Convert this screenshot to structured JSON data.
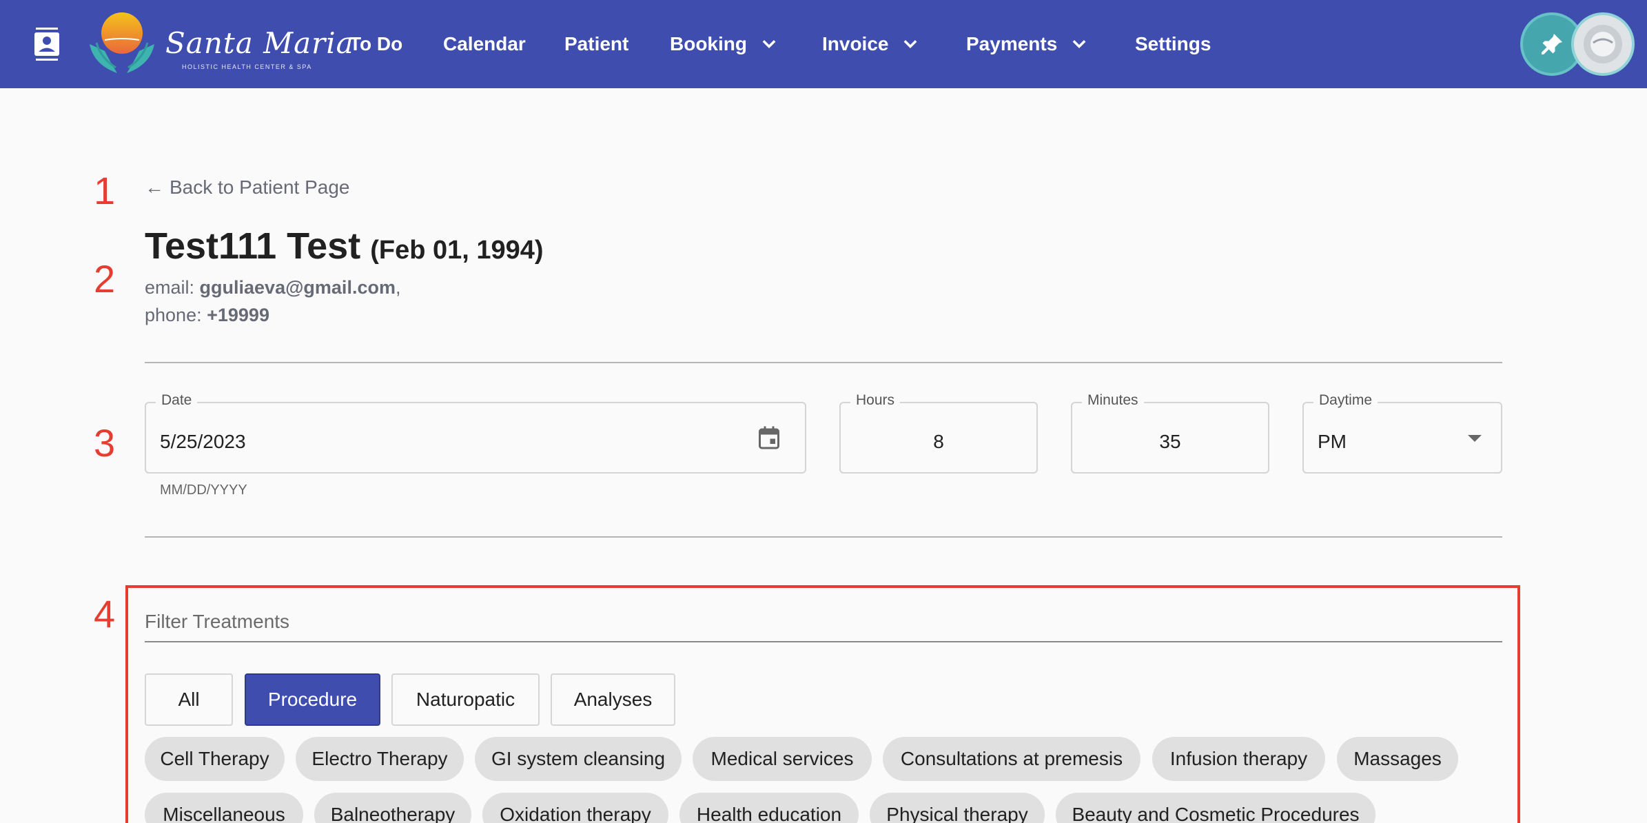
{
  "header": {
    "brand_name": "Santa Maria",
    "brand_tagline": "HOLISTIC HEALTH CENTER & SPA",
    "nav": [
      {
        "label": "To Do"
      },
      {
        "label": "Calendar"
      },
      {
        "label": "Patient"
      },
      {
        "label": "Booking"
      },
      {
        "label": "Invoice"
      },
      {
        "label": "Payments"
      },
      {
        "label": "Settings"
      }
    ],
    "accent_color": "#3f4eae"
  },
  "annotations": [
    "1",
    "2",
    "3",
    "4"
  ],
  "back_link": {
    "arrow": "←",
    "label": "Back to Patient Page"
  },
  "patient": {
    "name": "Test111 Test",
    "dob": "(Feb 01, 1994)",
    "email_label": "email:",
    "email": "gguliaeva@gmail.com",
    "email_suffix": ",",
    "phone_label": "phone:",
    "phone": "+19999"
  },
  "appointment": {
    "date_label": "Date",
    "date_value": "5/25/2023",
    "date_helper": "MM/DD/YYYY",
    "hours_label": "Hours",
    "hours_value": "8",
    "minutes_label": "Minutes",
    "minutes_value": "35",
    "daytime_label": "Daytime",
    "daytime_value": "PM"
  },
  "filter": {
    "placeholder": "Filter Treatments",
    "segments": [
      {
        "label": "All",
        "active": false
      },
      {
        "label": "Procedure",
        "active": true
      },
      {
        "label": "Naturopatic",
        "active": false
      },
      {
        "label": "Analyses",
        "active": false
      }
    ],
    "chips": [
      {
        "label": "Cell Therapy"
      },
      {
        "label": "Electro Therapy"
      },
      {
        "label": "GI system cleansing"
      },
      {
        "label": "Medical services"
      },
      {
        "label": "Consultations at premesis"
      },
      {
        "label": "Infusion therapy"
      },
      {
        "label": "Massages"
      },
      {
        "label": "Miscellaneous"
      },
      {
        "label": "Balneotherapy"
      },
      {
        "label": "Oxidation therapy"
      },
      {
        "label": "Health education"
      },
      {
        "label": "Physical therapy"
      },
      {
        "label": "Beauty and Cosmetic Procedures"
      }
    ]
  }
}
